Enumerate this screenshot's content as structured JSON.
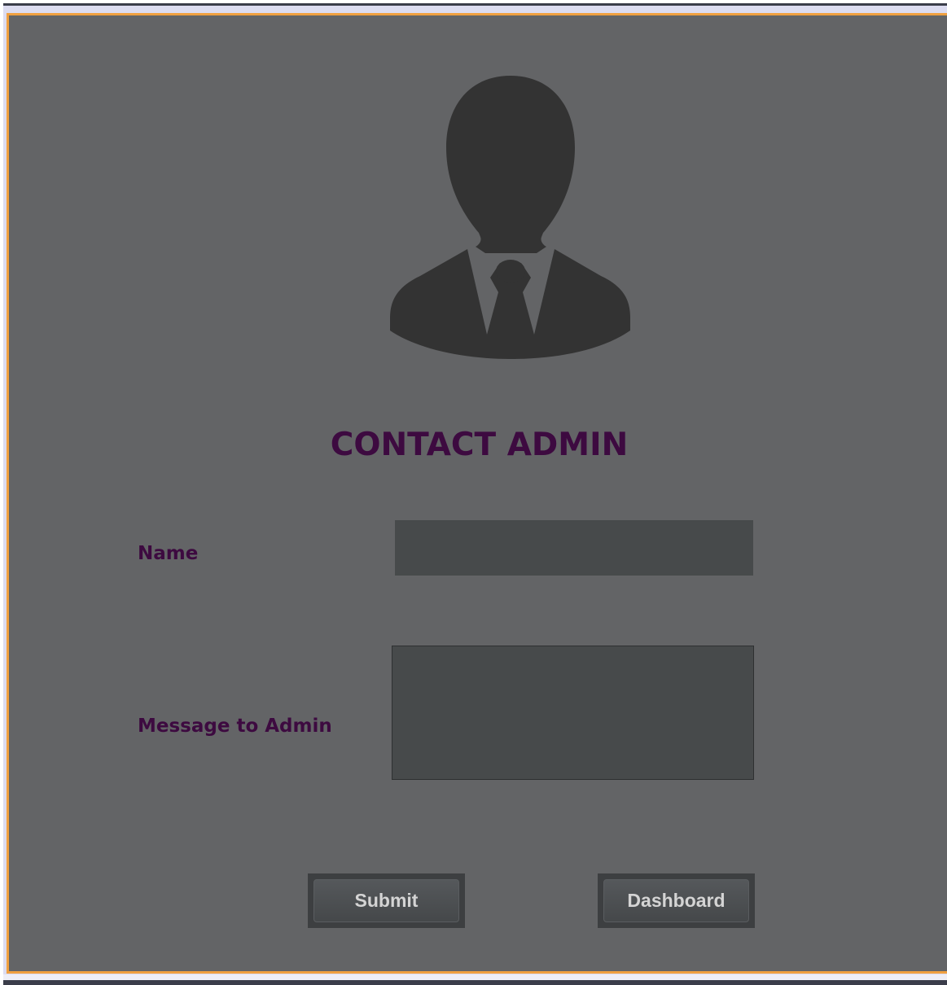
{
  "form": {
    "title": "CONTACT ADMIN",
    "avatar_icon": "user-silhouette-icon",
    "name_label": "Name",
    "name_value": "",
    "message_label": "Message to Admin",
    "message_value": "",
    "submit_label": "Submit",
    "dashboard_label": "Dashboard"
  },
  "colors": {
    "background": "#636466",
    "title_text": "#3d0a40",
    "input_bg": "#474a4b",
    "frame_border": "#f0a040",
    "avatar": "#333333"
  }
}
